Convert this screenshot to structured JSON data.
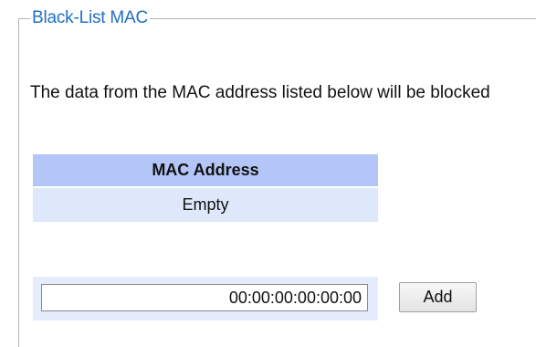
{
  "panel": {
    "legend": "Black-List MAC",
    "description": "The data from the MAC address listed below will be blocked"
  },
  "mac_table": {
    "header": "MAC Address",
    "rows": [
      "Empty"
    ]
  },
  "add_form": {
    "mac_value": "00:00:00:00:00:00",
    "add_label": "Add"
  }
}
